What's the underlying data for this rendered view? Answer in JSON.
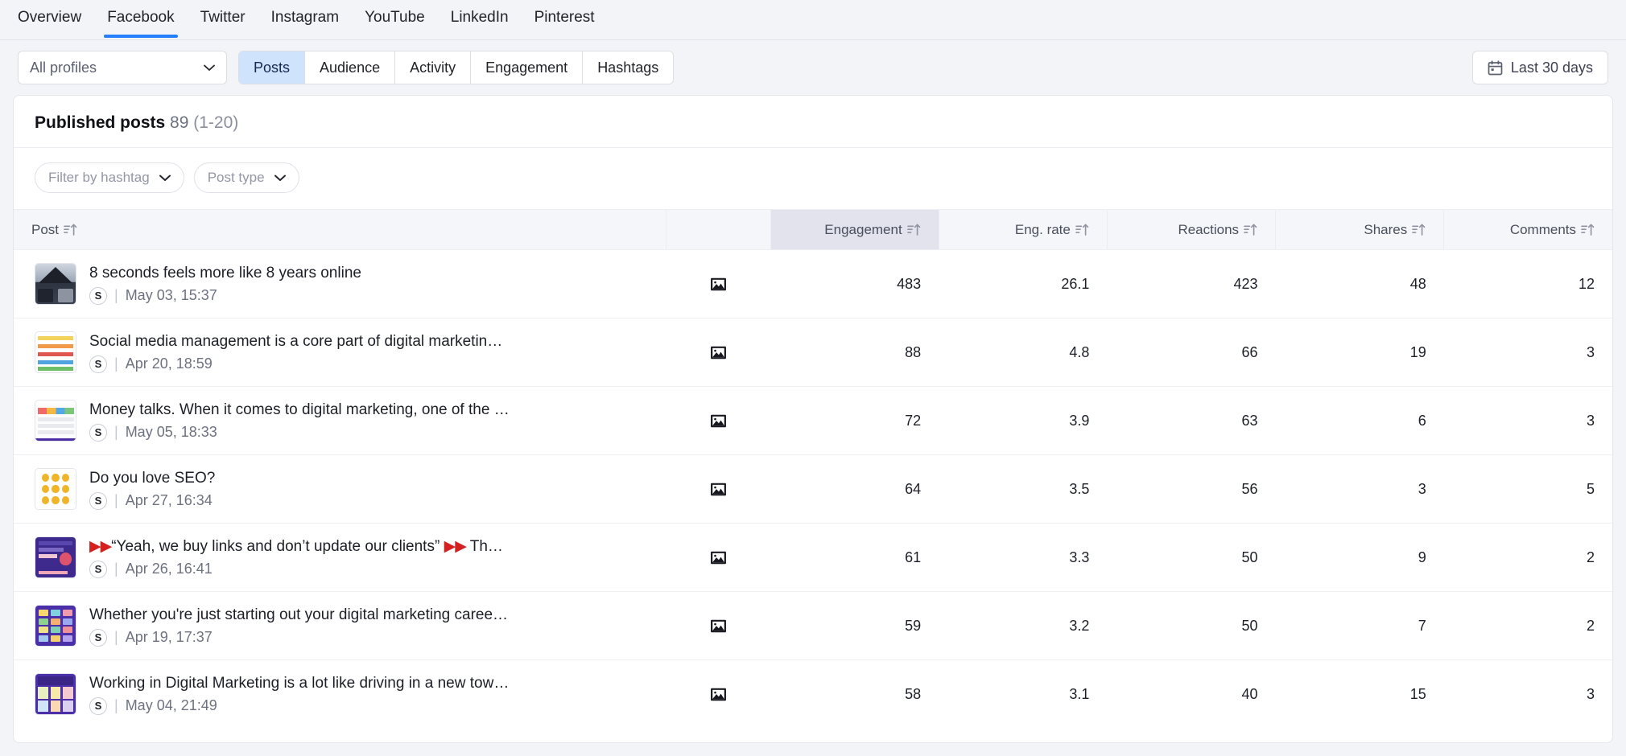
{
  "network_tabs": [
    {
      "label": "Overview",
      "active": false
    },
    {
      "label": "Facebook",
      "active": true
    },
    {
      "label": "Twitter",
      "active": false
    },
    {
      "label": "Instagram",
      "active": false
    },
    {
      "label": "YouTube",
      "active": false
    },
    {
      "label": "LinkedIn",
      "active": false
    },
    {
      "label": "Pinterest",
      "active": false
    }
  ],
  "filters": {
    "profile_select_value": "All profiles",
    "segments": [
      {
        "label": "Posts",
        "active": true
      },
      {
        "label": "Audience",
        "active": false
      },
      {
        "label": "Activity",
        "active": false
      },
      {
        "label": "Engagement",
        "active": false
      },
      {
        "label": "Hashtags",
        "active": false
      }
    ],
    "date_range_label": "Last 30 days",
    "date_icon": "calendar-icon"
  },
  "card": {
    "title": "Published posts",
    "count": "89",
    "range": "(1-20)",
    "sub_filters": [
      {
        "label": "Filter by hashtag",
        "icon": "chevron-down-icon"
      },
      {
        "label": "Post type",
        "icon": "chevron-down-icon"
      }
    ]
  },
  "table": {
    "columns": [
      {
        "label": "Post",
        "align": "left",
        "sorted": false,
        "icon": "sort-icon"
      },
      {
        "label": "Engagement",
        "align": "right",
        "sorted": true,
        "icon": "sort-icon"
      },
      {
        "label": "Eng. rate",
        "align": "right",
        "sorted": false,
        "icon": "sort-icon"
      },
      {
        "label": "Reactions",
        "align": "right",
        "sorted": false,
        "icon": "sort-icon"
      },
      {
        "label": "Shares",
        "align": "right",
        "sorted": false,
        "icon": "sort-icon"
      },
      {
        "label": "Comments",
        "align": "right",
        "sorted": false,
        "icon": "sort-icon"
      }
    ],
    "rows": [
      {
        "title": "8 seconds feels more like 8 years online",
        "profile_initial": "S",
        "date": "May 03, 15:37",
        "post_type_icon": "image-icon",
        "engagement": "483",
        "eng_rate": "26.1",
        "reactions": "423",
        "shares": "48",
        "comments": "12",
        "thumb_style": "photo-dark"
      },
      {
        "title": "Social media management is a core part of digital marketing, but as a s…",
        "profile_initial": "S",
        "date": "Apr 20, 18:59",
        "post_type_icon": "image-icon",
        "engagement": "88",
        "eng_rate": "4.8",
        "reactions": "66",
        "shares": "19",
        "comments": "3",
        "thumb_style": "list-light"
      },
      {
        "title": "Money talks. When it comes to digital marketing, one of the biggest fa…",
        "profile_initial": "S",
        "date": "May 05, 18:33",
        "post_type_icon": "image-icon",
        "engagement": "72",
        "eng_rate": "3.9",
        "reactions": "63",
        "shares": "6",
        "comments": "3",
        "thumb_style": "table-light"
      },
      {
        "title": "Do you love SEO?",
        "profile_initial": "S",
        "date": "Apr 27, 16:34",
        "post_type_icon": "image-icon",
        "engagement": "64",
        "eng_rate": "3.5",
        "reactions": "56",
        "shares": "3",
        "comments": "5",
        "thumb_style": "emoji-grid"
      },
      {
        "title": "▶▶“Yeah, we buy links and don’t update our clients” ▶▶ These are th…",
        "profile_initial": "S",
        "date": "Apr 26, 16:41",
        "post_type_icon": "image-icon",
        "engagement": "61",
        "eng_rate": "3.3",
        "reactions": "50",
        "shares": "9",
        "comments": "2",
        "thumb_style": "purple-chart"
      },
      {
        "title": "Whether you're just starting out your digital marketing career or you've…",
        "profile_initial": "S",
        "date": "Apr 19, 17:37",
        "post_type_icon": "image-icon",
        "engagement": "59",
        "eng_rate": "3.2",
        "reactions": "50",
        "shares": "7",
        "comments": "2",
        "thumb_style": "purple-grid"
      },
      {
        "title": "Working in Digital Marketing is a lot like driving in a new town for the fir…",
        "profile_initial": "S",
        "date": "May 04, 21:49",
        "post_type_icon": "image-icon",
        "engagement": "58",
        "eng_rate": "3.1",
        "reactions": "40",
        "shares": "15",
        "comments": "3",
        "thumb_style": "purple-cards"
      }
    ]
  },
  "colors": {
    "accent": "#247efe",
    "active_segment_bg": "#cfe3fd",
    "sorted_header_bg": "#e2e3ec",
    "page_bg": "#f3f4f7"
  }
}
